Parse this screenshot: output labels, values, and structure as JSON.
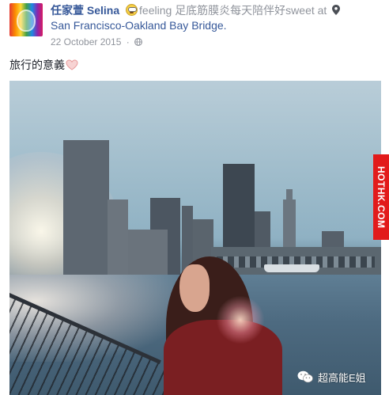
{
  "post": {
    "author": "任家萱 Selina",
    "feeling_prefix": "feeling",
    "feeling_text": "足底筋膜炎每天陪伴好sweet at",
    "location": "San Francisco-Oakland Bay Bridge.",
    "date": "22 October 2015",
    "date_separator": "·",
    "caption": "旅行的意義",
    "icons": {
      "feeling": "sweating-grin-emoji-icon",
      "location": "map-pin-icon",
      "audience": "globe-icon",
      "caption_end": "heart-icon"
    },
    "colors": {
      "link": "#365899",
      "meta": "#90949c"
    }
  },
  "side_tag": {
    "text": "HOTHK.COM",
    "color": "#e21b1b"
  },
  "watermark": {
    "text": "超高能E姐",
    "icon": "wechat-icon"
  }
}
